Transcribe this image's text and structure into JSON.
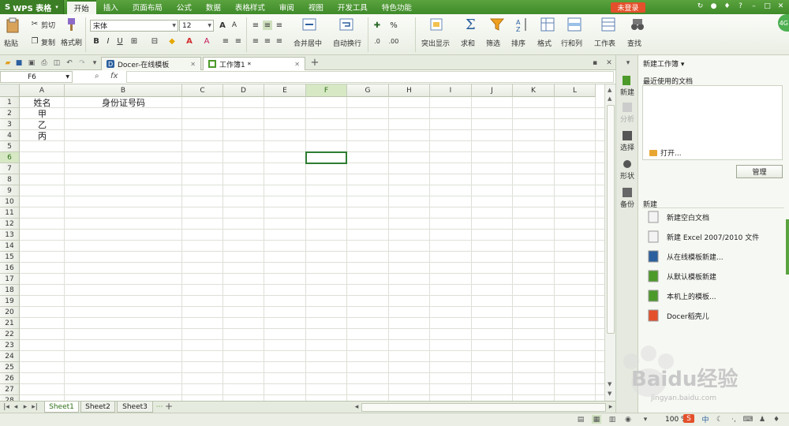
{
  "app": {
    "name": "WPS 表格",
    "logo": "S"
  },
  "menu": {
    "tabs": [
      "开始",
      "插入",
      "页面布局",
      "公式",
      "数据",
      "表格样式",
      "审阅",
      "视图",
      "开发工具",
      "特色功能"
    ],
    "active": "开始",
    "login": "未登录"
  },
  "ribbon": {
    "paste": "粘贴",
    "cut": "剪切",
    "copy": "复制",
    "format_painter": "格式刷",
    "font_name": "宋体",
    "font_size": "12",
    "bold": "B",
    "italic": "I",
    "underline": "U",
    "merge": "合并居中",
    "wrap": "自动换行",
    "percent": "%",
    "highlight": "突出显示",
    "sum": "求和",
    "filter": "筛选",
    "sort": "排序",
    "format": "格式",
    "rowcol": "行和列",
    "sheet": "工作表",
    "find": "查找"
  },
  "doc_tabs": [
    {
      "label": "Docer-在线模板",
      "active": false
    },
    {
      "label": "工作簿1 *",
      "active": true
    }
  ],
  "formula_bar": {
    "name_box": "F6",
    "fx": "fx"
  },
  "columns": [
    "A",
    "B",
    "C",
    "D",
    "E",
    "F",
    "G",
    "H",
    "I",
    "J",
    "K",
    "L"
  ],
  "selected_column": "F",
  "selected_row": "6",
  "rows": [
    "1",
    "2",
    "3",
    "4",
    "5",
    "6",
    "7",
    "8",
    "9",
    "10",
    "11",
    "12",
    "13",
    "14",
    "15",
    "16",
    "17",
    "18",
    "19",
    "20",
    "21",
    "22",
    "23",
    "24",
    "25",
    "26",
    "27",
    "28"
  ],
  "cells": {
    "A1": "姓名",
    "B1": "身份证号码",
    "A2": "甲",
    "A3": "乙",
    "A4": "丙"
  },
  "sheets": [
    {
      "label": "Sheet1",
      "active": true
    },
    {
      "label": "Sheet2",
      "active": false
    },
    {
      "label": "Sheet3",
      "active": false
    }
  ],
  "status": {
    "zoom": "100 %"
  },
  "side_strip": [
    "新建",
    "分析",
    "选择",
    "形状",
    "备份"
  ],
  "task_pane": {
    "title": "新建工作簿",
    "recent": "最近使用的文档",
    "open": "打开...",
    "manage": "管理",
    "new_header": "新建",
    "items": [
      "新建空白文档",
      "新建 Excel 2007/2010 文件",
      "从在线模板新建...",
      "从默认模板新建",
      "本机上的模板...",
      "Docer稻壳儿"
    ]
  },
  "watermark": {
    "text": "Baidu经验",
    "url": "jingyan.baidu.com"
  },
  "avatar": "4G"
}
